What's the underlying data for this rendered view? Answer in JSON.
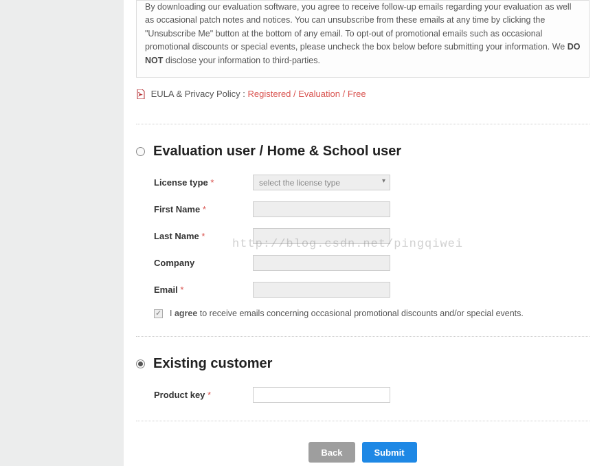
{
  "agreement": {
    "text_before_bold": "By downloading our evaluation software, you agree to receive follow-up emails regarding your evaluation as well as occasional patch notes and notices. You can unsubscribe from these emails at any time by clicking the \"Unsubscribe Me\" button at the bottom of any email. To opt-out of promotional emails such as occasional promotional discounts or special events, please uncheck the box below before submitting your information. We ",
    "bold": "DO NOT",
    "text_after_bold": " disclose your information to third-parties."
  },
  "doc_links": {
    "prefix": "EULA & Privacy Policy :",
    "registered": "Registered",
    "evaluation": "Evaluation",
    "free": "Free"
  },
  "section_eval": {
    "title": "Evaluation user / Home & School user",
    "labels": {
      "license_type": "License type",
      "first_name": "First Name",
      "last_name": "Last Name",
      "company": "Company",
      "email": "Email"
    },
    "select_placeholder": "select the license type",
    "required_mark": "*",
    "consent_prefix": "I ",
    "consent_bold": "agree",
    "consent_suffix": " to receive emails concerning occasional promotional discounts and/or special events."
  },
  "section_existing": {
    "title": "Existing customer",
    "product_key_label": "Product key"
  },
  "buttons": {
    "back": "Back",
    "submit": "Submit"
  },
  "watermark": "http://blog.csdn.net/pingqiwei"
}
